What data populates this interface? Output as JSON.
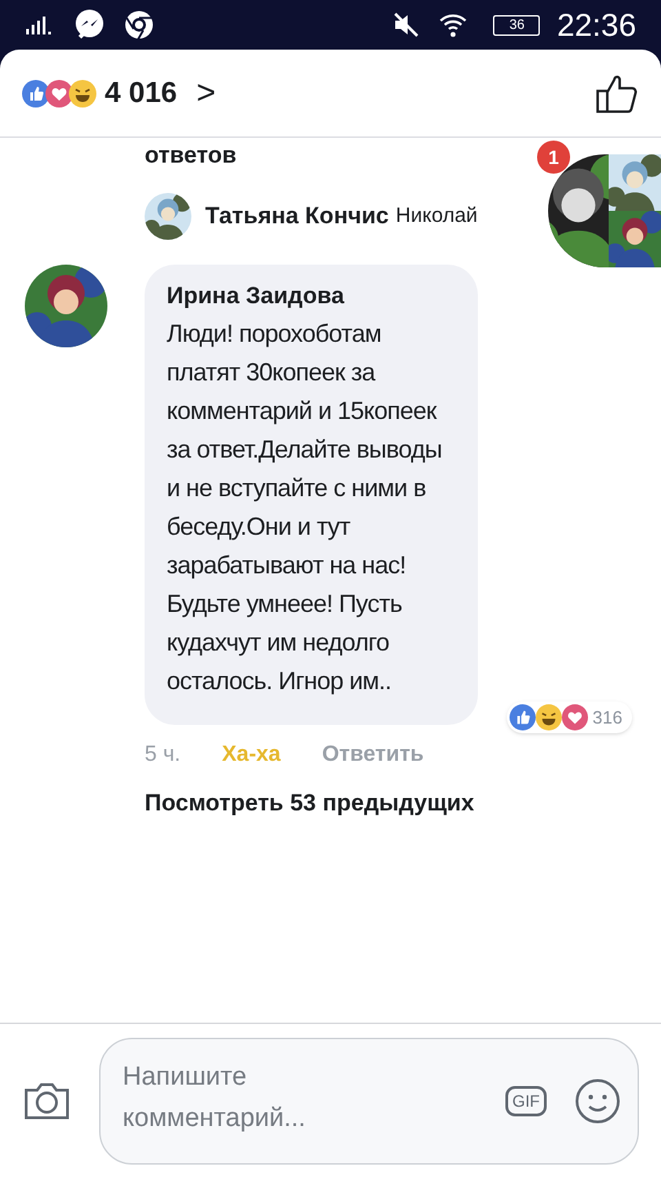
{
  "status_bar": {
    "battery": "36",
    "time": "22:36"
  },
  "header": {
    "reaction_count": "4 016",
    "chevron": ">"
  },
  "replies_tail": "ответов",
  "reply_preview": {
    "author": "Татьяна Кончис",
    "text": "Николай"
  },
  "chat_head": {
    "badge": "1"
  },
  "comment": {
    "author": "Ирина Заидова",
    "text": "Люди! порохоботам платят 30копеек за комментарий и 15копеек за ответ.Делайте выводы и не вступайте с ними в беседу.Они и тут зарабатывают на нас!Будьте умнеее! Пусть кудахчут им недолго осталось. Игнор им..",
    "reaction_count": "316",
    "time": "5 ч.",
    "actions": [
      {
        "label": "Ха-ха",
        "selected": true
      },
      {
        "label": "Ответить",
        "selected": false
      }
    ]
  },
  "more_link": "Посмотреть 53 предыдущих",
  "composer": {
    "placeholder": "Напишите комментарий...",
    "gif": "GIF"
  }
}
